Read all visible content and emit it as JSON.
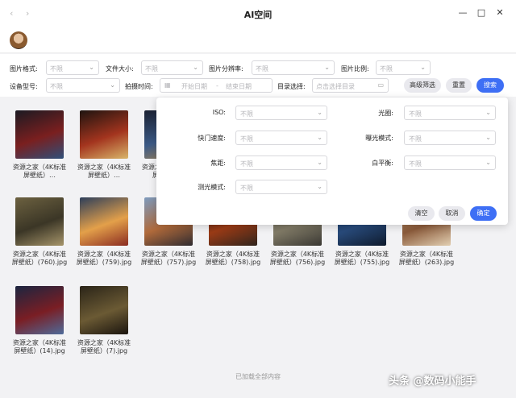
{
  "window": {
    "title": "AI空间",
    "back": "‹",
    "forward": "›",
    "minimize": "—",
    "maximize": "□",
    "close": "✕"
  },
  "filters": {
    "format": {
      "label": "图片格式:",
      "value": "不限"
    },
    "size": {
      "label": "文件大小:",
      "value": "不限"
    },
    "resolution": {
      "label": "图片分辨率:",
      "value": "不限"
    },
    "ratio": {
      "label": "图片比例:",
      "value": "不限"
    },
    "device": {
      "label": "设备型号:",
      "value": "不限"
    },
    "date": {
      "label": "拍摄时间:",
      "start_placeholder": "开始日期",
      "separator": "-",
      "end_placeholder": "结束日期"
    },
    "directory": {
      "label": "目录选择:",
      "placeholder": "点击选择目录"
    },
    "advanced_label": "高级筛选",
    "reset_label": "重置",
    "search_label": "搜索"
  },
  "advanced": {
    "iso": {
      "label": "ISO:",
      "value": "不限"
    },
    "aperture": {
      "label": "光圈:",
      "value": "不限"
    },
    "shutter": {
      "label": "快门速度:",
      "value": "不限"
    },
    "exposure": {
      "label": "曝光模式:",
      "value": "不限"
    },
    "focal": {
      "label": "焦距:",
      "value": "不限"
    },
    "white_balance": {
      "label": "白平衡:",
      "value": "不限"
    },
    "metering": {
      "label": "测光模式:",
      "value": "不限"
    },
    "clear_label": "清空",
    "cancel_label": "取消",
    "confirm_label": "确定"
  },
  "images": [
    {
      "line1": "资源之家（4K标准",
      "line2": "屏壁纸）…",
      "colors": [
        "#1b1a22",
        "#7a1f1f",
        "#2f4f7a"
      ]
    },
    {
      "line1": "资源之家（4K标准",
      "line2": "屏壁纸）…",
      "colors": [
        "#1e1410",
        "#a3341e",
        "#d8b56a"
      ]
    },
    {
      "line1": "资源之家（4K标准",
      "line2": "屏壁纸）…",
      "colors": [
        "#1a2030",
        "#3c5a86",
        "#b48a4a"
      ]
    },
    {
      "line1": "资源之家（4K标准",
      "line2": "屏壁纸）(760).jpg",
      "colors": [
        "#6c6140",
        "#3b3626",
        "#a6956a"
      ]
    },
    {
      "line1": "资源之家（4K标准",
      "line2": "屏壁纸）(759).jpg",
      "colors": [
        "#2d3e5a",
        "#e3a04a",
        "#8a2b21"
      ]
    },
    {
      "line1": "资源之家（4K标准",
      "line2": "屏壁纸）(757).jpg",
      "colors": [
        "#7d9abd",
        "#b06a3b",
        "#2f2b30"
      ]
    },
    {
      "line1": "资源之家（4K标准",
      "line2": "屏壁纸）(758).jpg",
      "colors": [
        "#1a1614",
        "#9b3b16",
        "#2f241c"
      ]
    },
    {
      "line1": "资源之家（4K标准",
      "line2": "屏壁纸）(756).jpg",
      "colors": [
        "#5b5a52",
        "#807a66",
        "#3a3833"
      ]
    },
    {
      "line1": "资源之家（4K标准",
      "line2": "屏壁纸）(755).jpg",
      "colors": [
        "#123058",
        "#284a7a",
        "#0e1a2c"
      ]
    },
    {
      "line1": "资源之家（4K标准",
      "line2": "屏壁纸）(263).jpg",
      "colors": [
        "#c3a27a",
        "#8a5a3a",
        "#e2cfb2"
      ]
    },
    {
      "line1": "资源之家（4K标准",
      "line2": "屏壁纸）(14).jpg",
      "colors": [
        "#1b2540",
        "#7a1e24",
        "#4e6b9a"
      ]
    },
    {
      "line1": "资源之家（4K标准",
      "line2": "屏壁纸）(7).jpg",
      "colors": [
        "#2a2418",
        "#6b5a34",
        "#1a140e"
      ]
    }
  ],
  "footer": "已加载全部内容",
  "watermark": "头条 @数码小能手"
}
